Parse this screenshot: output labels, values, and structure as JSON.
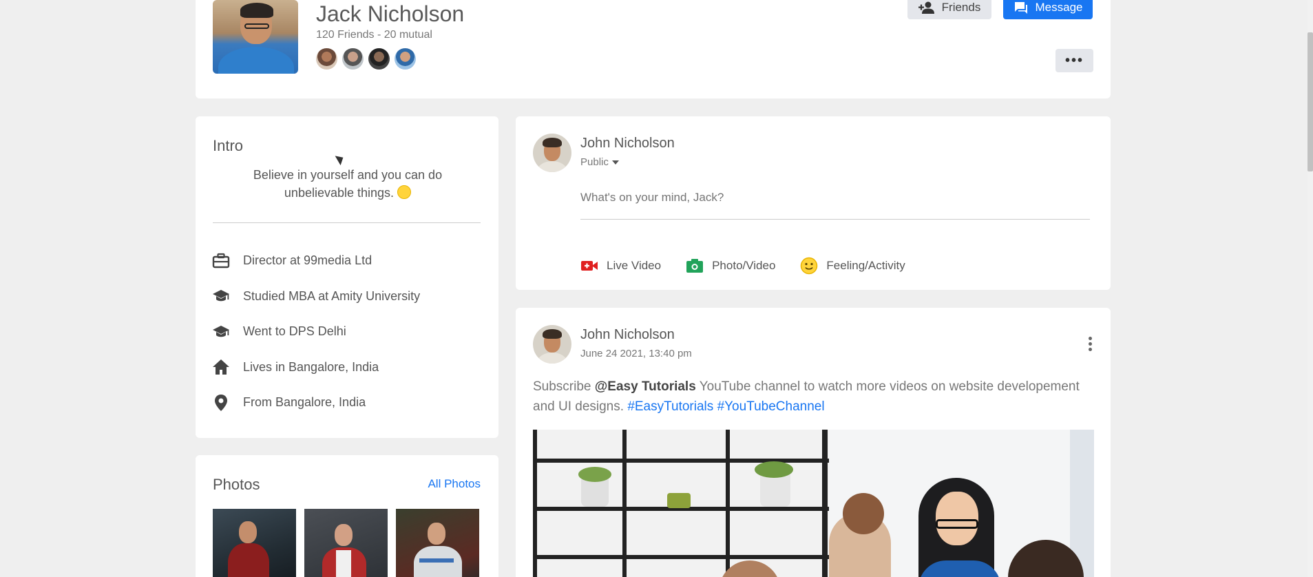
{
  "profile": {
    "name": "Jack Nicholson",
    "friends_count": "120 Friends - 20 mutual",
    "friends_button": "Friends",
    "message_button": "Message",
    "more_button": "•••"
  },
  "intro": {
    "title": "Intro",
    "bio": "Believe in yourself and you can do unbelievable things.",
    "items": [
      {
        "icon": "briefcase-icon",
        "label": "Director at 99media Ltd"
      },
      {
        "icon": "graduation-cap-icon",
        "label": "Studied MBA at Amity University"
      },
      {
        "icon": "graduation-cap-icon",
        "label": "Went to DPS Delhi"
      },
      {
        "icon": "home-icon",
        "label": "Lives in Bangalore, India"
      },
      {
        "icon": "location-pin-icon",
        "label": "From Bangalore, India"
      }
    ]
  },
  "photos": {
    "title": "Photos",
    "all_link": "All Photos"
  },
  "composer": {
    "author": "John Nicholson",
    "privacy": "Public",
    "placeholder": "What's on your mind, Jack?",
    "actions": [
      {
        "icon": "live-video-icon",
        "label": "Live Video",
        "color": "#e02020"
      },
      {
        "icon": "camera-icon",
        "label": "Photo/Video",
        "color": "#21a35a"
      },
      {
        "icon": "smiley-icon",
        "label": "Feeling/Activity",
        "color": "#f5c518"
      }
    ]
  },
  "post": {
    "author": "John Nicholson",
    "timestamp": "June 24 2021, 13:40 pm",
    "text_prefix": "Subscribe ",
    "mention": "@Easy Tutorials",
    "text_middle": " YouTube channel to watch more videos on website developement and UI designs. ",
    "hashtag_1": "#EasyTutorials",
    "hashtag_2": "#YouTubeChannel"
  },
  "colors": {
    "accent": "#1876f2",
    "background": "#efefef"
  }
}
